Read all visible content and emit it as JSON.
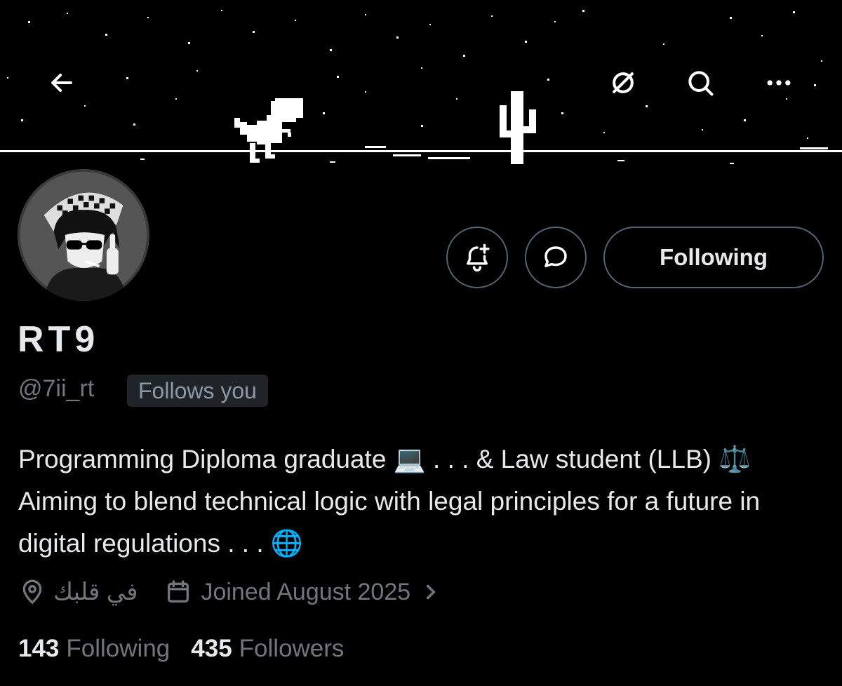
{
  "header": {
    "back_icon": "arrow-left-icon",
    "grok_icon": "grok-slash-icon",
    "search_icon": "search-icon",
    "more_icon": "more-horizontal-icon"
  },
  "banner": {
    "theme": "chrome-dino-night-scene",
    "background": "#000000"
  },
  "profile": {
    "display_name": "RT9",
    "handle": "@7ii_rt",
    "follows_you_badge": "Follows you",
    "bio": "Programming Diploma graduate 💻 . . . & Law student (LLB) ⚖️ Aiming to blend technical logic with legal principles for a future in digital regulations . . . 🌐",
    "location": "في قلبك",
    "joined": "Joined August 2025"
  },
  "actions": {
    "notify_icon": "bell-plus-icon",
    "message_icon": "message-bubble-icon",
    "following_label": "Following"
  },
  "stats": {
    "following_count": "143",
    "following_label": "Following",
    "followers_count": "435",
    "followers_label": "Followers"
  },
  "colors": {
    "background": "#000000",
    "primary_text": "#e7e9ea",
    "secondary_text": "#71767b",
    "border": "#536471",
    "badge_bg": "#202327"
  }
}
